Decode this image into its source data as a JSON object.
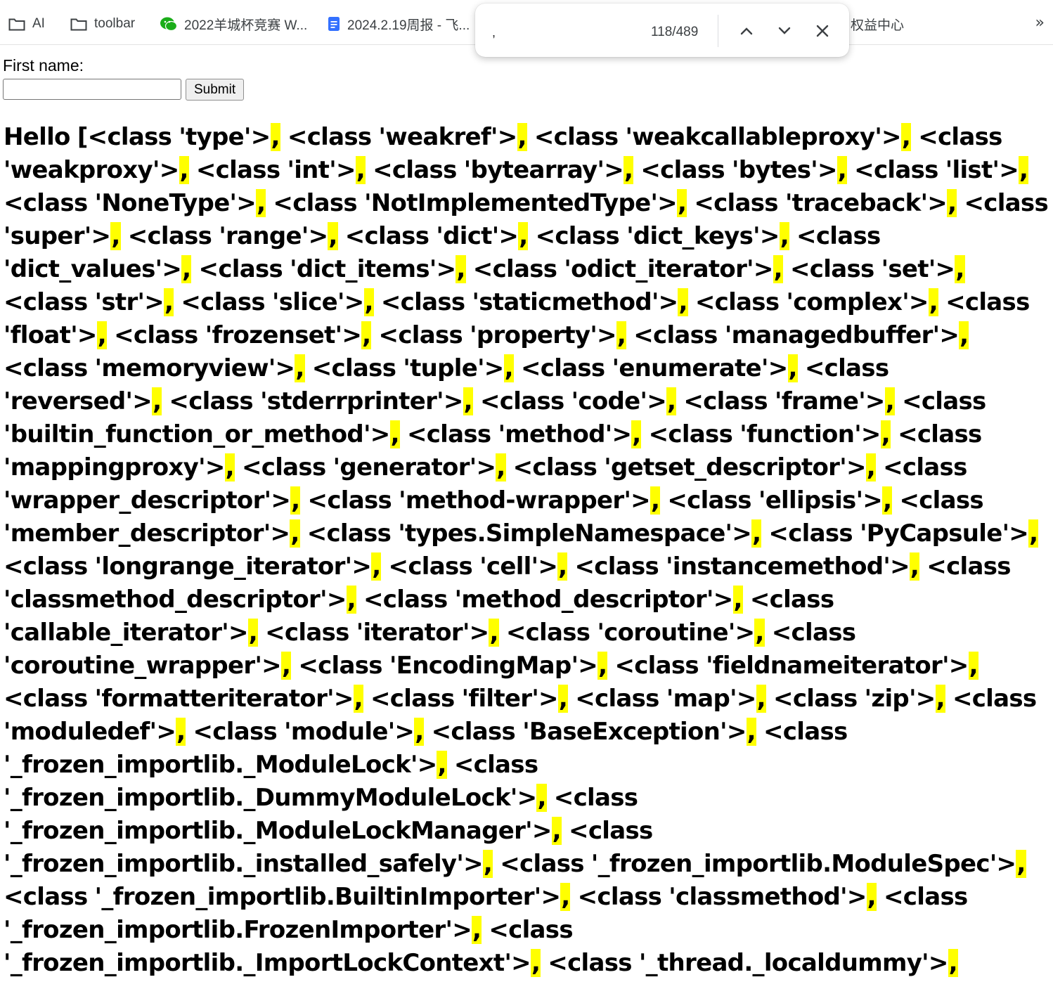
{
  "bookmarks_bar": {
    "items": [
      {
        "label": "AI",
        "icon": "folder-icon"
      },
      {
        "label": "toolbar",
        "icon": "folder-icon"
      },
      {
        "label": "2022羊城杯竞赛 W...",
        "icon": "wechat-icon"
      },
      {
        "label": "2024.2.19周报 - 飞...",
        "icon": "document-icon"
      },
      {
        "label": "权益中心",
        "icon": "none"
      }
    ],
    "more_icon": "chevron-double-right-icon"
  },
  "find_bar": {
    "query": ",",
    "match_count": "118/489",
    "prev_icon": "chevron-up-icon",
    "next_icon": "chevron-down-icon",
    "close_icon": "close-icon"
  },
  "form": {
    "label": "First name:",
    "input_value": "",
    "submit_label": "Submit"
  },
  "output": {
    "highlight_color": "#ffff00",
    "prefix": "Hello [",
    "items": [
      "<class 'type'>",
      "<class 'weakref'>",
      "<class 'weakcallableproxy'>",
      "<class 'weakproxy'>",
      "<class 'int'>",
      "<class 'bytearray'>",
      "<class 'bytes'>",
      "<class 'list'>",
      "<class 'NoneType'>",
      "<class 'NotImplementedType'>",
      "<class 'traceback'>",
      "<class 'super'>",
      "<class 'range'>",
      "<class 'dict'>",
      "<class 'dict_keys'>",
      "<class 'dict_values'>",
      "<class 'dict_items'>",
      "<class 'odict_iterator'>",
      "<class 'set'>",
      "<class 'str'>",
      "<class 'slice'>",
      "<class 'staticmethod'>",
      "<class 'complex'>",
      "<class 'float'>",
      "<class 'frozenset'>",
      "<class 'property'>",
      "<class 'managedbuffer'>",
      "<class 'memoryview'>",
      "<class 'tuple'>",
      "<class 'enumerate'>",
      "<class 'reversed'>",
      "<class 'stderrprinter'>",
      "<class 'code'>",
      "<class 'frame'>",
      "<class 'builtin_function_or_method'>",
      "<class 'method'>",
      "<class 'function'>",
      "<class 'mappingproxy'>",
      "<class 'generator'>",
      "<class 'getset_descriptor'>",
      "<class 'wrapper_descriptor'>",
      "<class 'method-wrapper'>",
      "<class 'ellipsis'>",
      "<class 'member_descriptor'>",
      "<class 'types.SimpleNamespace'>",
      "<class 'PyCapsule'>",
      "<class 'longrange_iterator'>",
      "<class 'cell'>",
      "<class 'instancemethod'>",
      "<class 'classmethod_descriptor'>",
      "<class 'method_descriptor'>",
      "<class 'callable_iterator'>",
      "<class 'iterator'>",
      "<class 'coroutine'>",
      "<class 'coroutine_wrapper'>",
      "<class 'EncodingMap'>",
      "<class 'fieldnameiterator'>",
      "<class 'formatteriterator'>",
      "<class 'filter'>",
      "<class 'map'>",
      "<class 'zip'>",
      "<class 'moduledef'>",
      "<class 'module'>",
      "<class 'BaseException'>",
      "<class '_frozen_importlib._ModuleLock'>",
      "<class '_frozen_importlib._DummyModuleLock'>",
      "<class '_frozen_importlib._ModuleLockManager'>",
      "<class '_frozen_importlib._installed_safely'>",
      "<class '_frozen_importlib.ModuleSpec'>",
      "<class '_frozen_importlib.BuiltinImporter'>",
      "<class 'classmethod'>",
      "<class '_frozen_importlib.FrozenImporter'>",
      "<class '_frozen_importlib._ImportLockContext'>",
      "<class '_thread._localdummy'>"
    ],
    "separator": ","
  }
}
